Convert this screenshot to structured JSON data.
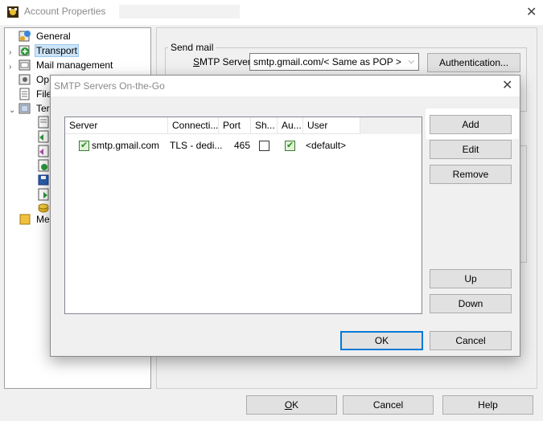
{
  "window": {
    "title": "Account Properties",
    "close_glyph": "✕"
  },
  "tree": {
    "items": [
      {
        "label": "General",
        "icon": "general-icon"
      },
      {
        "label": "Transport",
        "icon": "transport-icon",
        "selected": true
      },
      {
        "label": "Mail management",
        "icon": "mail-management-icon"
      },
      {
        "label": "Op",
        "icon": "options-icon"
      },
      {
        "label": "File",
        "icon": "files-icon"
      },
      {
        "label": "Ter",
        "icon": "templates-icon"
      },
      {
        "label": "Me",
        "icon": "message-folder-icon"
      }
    ]
  },
  "send_mail": {
    "group_title": "Send mail",
    "smtp_label_underlined": "S",
    "smtp_label_rest": "MTP Server",
    "smtp_value": "smtp.gmail.com/< Same as POP >",
    "authentication_button": "Authentication..."
  },
  "footer": {
    "ok_underlined": "O",
    "ok_rest": "K",
    "cancel": "Cancel",
    "help": "Help"
  },
  "dialog": {
    "title": "SMTP Servers On-the-Go",
    "close_glyph": "✕",
    "columns": [
      "Server",
      "Connecti...",
      "Port",
      "Sh...",
      "Au...",
      "User"
    ],
    "rows": [
      {
        "enabled": true,
        "server": "smtp.gmail.com",
        "connection": "TLS - dedi...",
        "port": "465",
        "shared": false,
        "auth": true,
        "user": "<default>"
      }
    ],
    "buttons": {
      "add": "Add",
      "edit": "Edit",
      "remove": "Remove",
      "up": "Up",
      "down": "Down",
      "ok": "OK",
      "cancel": "Cancel"
    }
  },
  "colors": {
    "selection": "#cce4f7",
    "default_button_border": "#0078d7"
  }
}
